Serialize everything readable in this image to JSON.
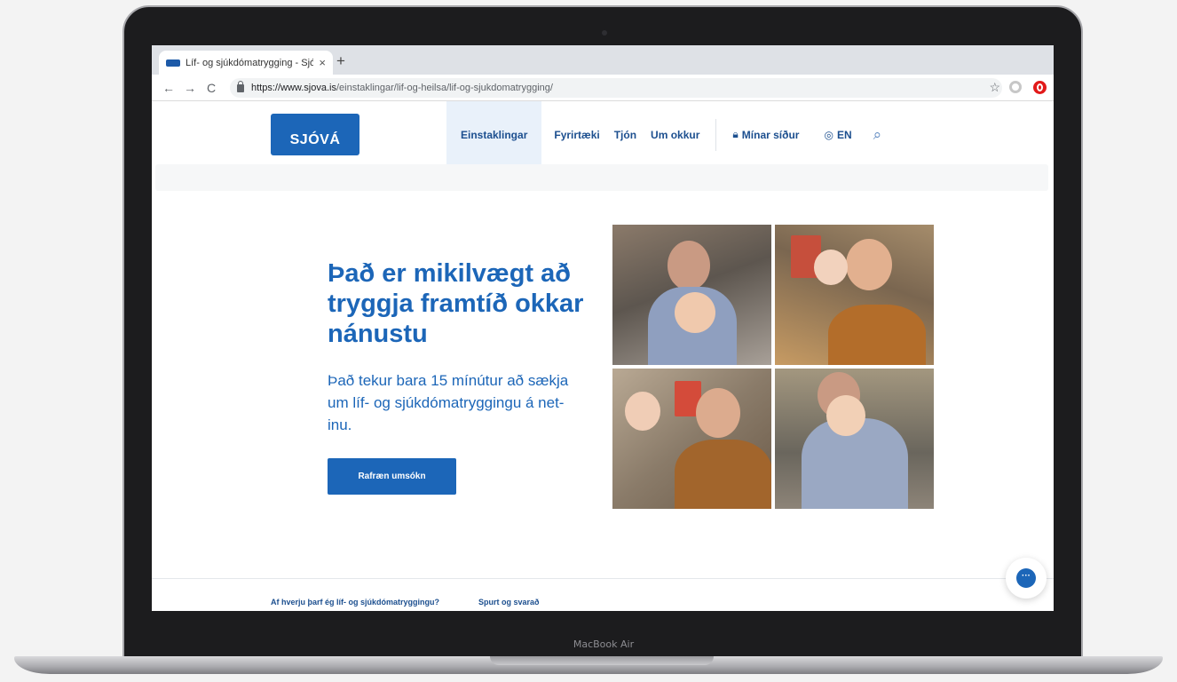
{
  "device": {
    "label": "MacBook Air"
  },
  "browser": {
    "tab_title": "Líf- og sjúkdómatrygging - Sjó",
    "tab_close": "×",
    "new_tab": "+",
    "back": "←",
    "forward": "→",
    "reload": "C",
    "url_host": "https://www.sjova.is",
    "url_path": "/einstaklingar/lif-og-heilsa/lif-og-sjukdomatrygging/",
    "bookmark_icon": "☆"
  },
  "site": {
    "logo": "SJÓVÁ",
    "nav": {
      "individuals": "Einstaklingar",
      "companies": "Fyrirtæki",
      "claims": "Tjón",
      "about": "Um okkur",
      "my_pages": "Mínar síður",
      "language": "EN"
    },
    "hero": {
      "title": "Það er mikilvægt að tryggja framtíð okkar nánustu",
      "text": "Það tekur bara 15 mínútur að sækja um líf- og sjúkdómatryggingu á net-inu.",
      "button": "Rafræn umsókn"
    },
    "bottom_links": {
      "why": "Af hverju þarf ég líf- og sjúkdómatryggingu?",
      "faq": "Spurt og svarað"
    },
    "chat": "···"
  },
  "colors": {
    "brand_blue": "#1c66b8",
    "nav_active_bg": "#e9f1fa"
  }
}
